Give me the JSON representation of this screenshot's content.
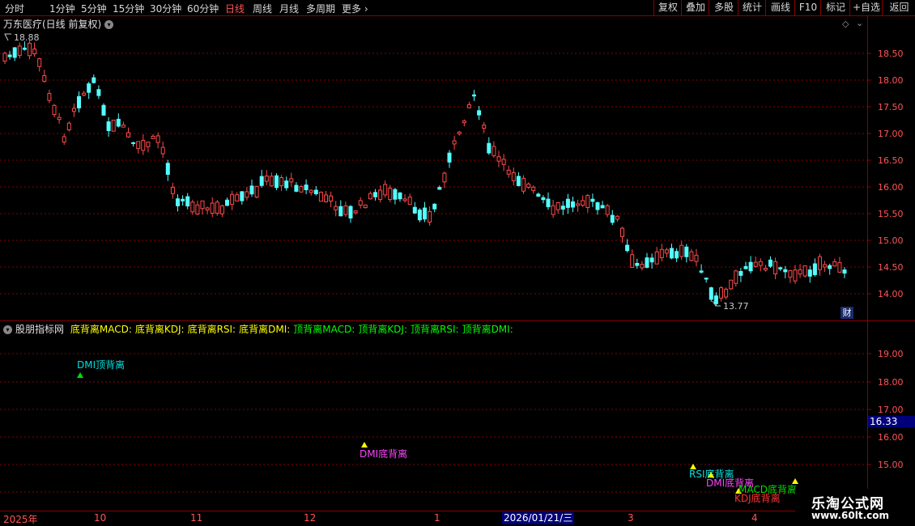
{
  "toolbar": {
    "periods": [
      "分时",
      "1分钟",
      "5分钟",
      "15分钟",
      "30分钟",
      "60分钟",
      "日线",
      "周线",
      "月线",
      "多周期",
      "更多"
    ],
    "active_period": "日线",
    "right_buttons": [
      "复权",
      "叠加",
      "多股",
      "统计",
      "画线",
      "F10",
      "标记",
      "+自选",
      "返回"
    ]
  },
  "main": {
    "title": "万东医疗(日线 前复权)",
    "high_label": "18.88",
    "low_label": "13.77",
    "y_ticks": [
      "18.50",
      "18.00",
      "17.50",
      "17.00",
      "16.50",
      "16.00",
      "15.50",
      "15.00",
      "14.50",
      "14.00"
    ],
    "cai_label": "财"
  },
  "sub": {
    "title": "股朋指标网",
    "legend": [
      {
        "text": "底背离MACD:",
        "color": "#ffff00"
      },
      {
        "text": "底背离KDJ:",
        "color": "#ffff00"
      },
      {
        "text": "底背离RSI:",
        "color": "#ffff00"
      },
      {
        "text": "底背离DMI:",
        "color": "#ffff00"
      },
      {
        "text": "顶背离MACD:",
        "color": "#00ff00"
      },
      {
        "text": "顶背离KDJ:",
        "color": "#00ff00"
      },
      {
        "text": "顶背离RSI:",
        "color": "#00ff00"
      },
      {
        "text": "顶背离DMI:",
        "color": "#00ff00"
      }
    ],
    "y_ticks": [
      "19.00",
      "18.00",
      "17.00",
      "16.00",
      "15.00"
    ],
    "current_price": "16.33",
    "signals": [
      {
        "label": "DMI顶背离",
        "color": "#00e0e0",
        "marker": "#00dd00"
      },
      {
        "label": "DMI底背离",
        "color": "#ff44ff",
        "marker": "#ffff00"
      },
      {
        "label": "RSI底背离",
        "color": "#00e0e0",
        "marker": "#ffff00"
      },
      {
        "label": "DMI底背离",
        "color": "#ff44ff",
        "marker": "#ffff00"
      },
      {
        "label": "KDJ底背离",
        "color": "#ff3333",
        "marker": "#ffff00"
      },
      {
        "label": "MACD底背离",
        "color": "#00dd00",
        "marker": "#ffff00"
      }
    ]
  },
  "xaxis": {
    "labels": [
      "2025年",
      "10",
      "11",
      "12",
      "1",
      "3",
      "4"
    ],
    "highlight": "2026/01/21/三"
  },
  "watermark": {
    "title": "乐淘公式网",
    "url": "www.60lt.com"
  },
  "colors": {
    "up": "#ff4a4a",
    "down": "#54ffff",
    "grid": "#8a0000"
  }
}
